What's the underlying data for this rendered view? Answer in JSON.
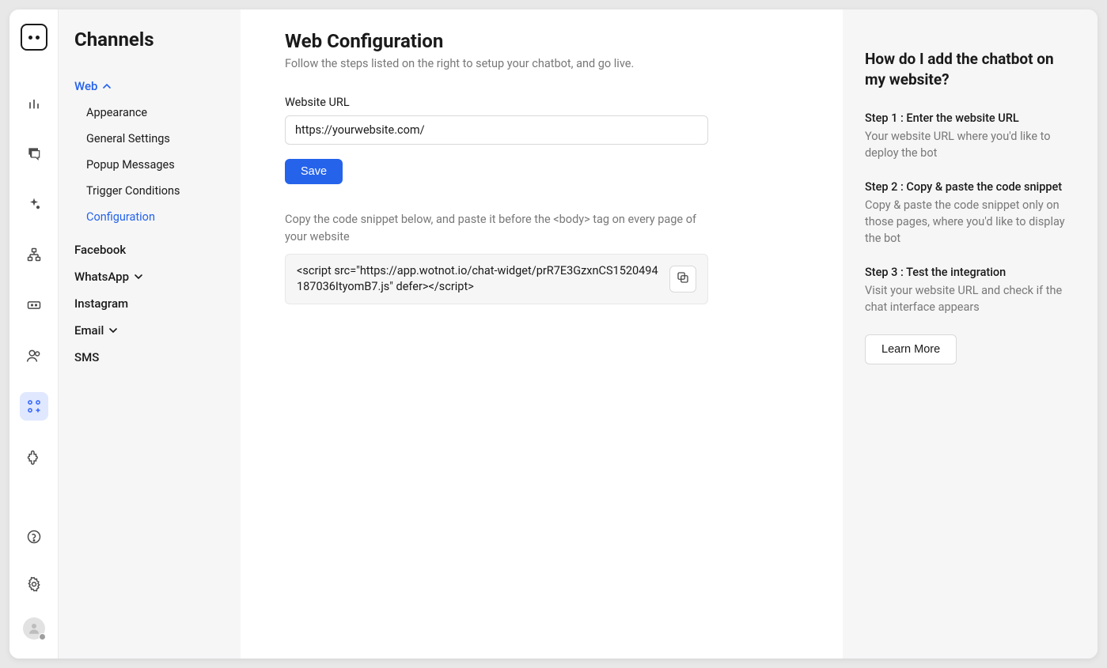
{
  "sidebar": {
    "title": "Channels",
    "channels": [
      {
        "label": "Web",
        "expanded": true,
        "sub": [
          {
            "label": "Appearance"
          },
          {
            "label": "General Settings"
          },
          {
            "label": "Popup Messages"
          },
          {
            "label": "Trigger Conditions"
          },
          {
            "label": "Configuration",
            "active": true
          }
        ]
      },
      {
        "label": "Facebook"
      },
      {
        "label": "WhatsApp",
        "hasChevron": true
      },
      {
        "label": "Instagram"
      },
      {
        "label": "Email",
        "hasChevron": true
      },
      {
        "label": "SMS"
      }
    ]
  },
  "main": {
    "title": "Web Configuration",
    "subtitle": "Follow the steps listed on the right to setup your chatbot, and go live.",
    "urlLabel": "Website URL",
    "urlValue": "https://yourwebsite.com/",
    "saveBtn": "Save",
    "snippetDesc": "Copy the code snippet below, and paste it before the <body> tag on every page of your website",
    "codeSnippet": "<script src=\"https://app.wotnot.io/chat-widget/prR7E3GzxnCS1520494187036ItyomB7.js\" defer></script>"
  },
  "right": {
    "title": "How do I add the chatbot on my website?",
    "steps": [
      {
        "title": "Step 1 : Enter the website URL",
        "desc": "Your website URL where you'd like to deploy the bot"
      },
      {
        "title": "Step 2 : Copy & paste the code snippet",
        "desc": "Copy & paste the code snippet only on those pages, where you'd like to display the bot"
      },
      {
        "title": "Step 3 : Test the integration",
        "desc": "Visit your website URL and check if the chat interface appears"
      }
    ],
    "learnBtn": "Learn More"
  }
}
